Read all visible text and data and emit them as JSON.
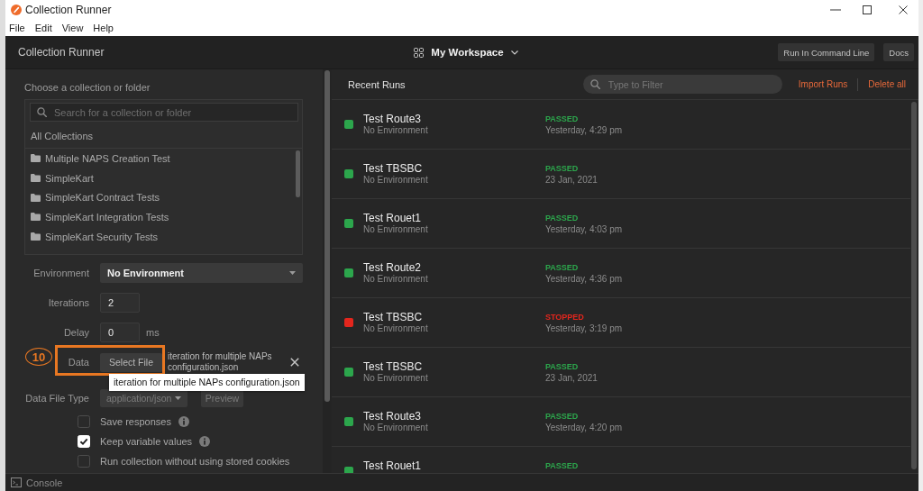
{
  "window": {
    "title": "Collection Runner"
  },
  "menu": [
    "File",
    "Edit",
    "View",
    "Help"
  ],
  "header": {
    "title": "Collection Runner",
    "workspace": "My Workspace",
    "buttons": [
      "Run In Command Line",
      "Docs"
    ]
  },
  "collection_picker": {
    "label": "Choose a collection or folder",
    "search": {
      "placeholder": "Search for a collection or folder"
    },
    "heading": "All Collections",
    "items": [
      "Multiple NAPS Creation Test",
      "SimpleKart",
      "SimpleKart Contract Tests",
      "SimpleKart Integration Tests",
      "SimpleKart Security Tests"
    ]
  },
  "settings": {
    "environment": {
      "label": "Environment",
      "value": "No Environment"
    },
    "iterations": {
      "label": "Iterations",
      "value": "2"
    },
    "delay": {
      "label": "Delay",
      "value": "0",
      "unit": "ms"
    },
    "data": {
      "label": "Data",
      "button": "Select File",
      "file_name": "iteration for multiple NAPs configuration.json",
      "tooltip": "iteration for multiple NAPs configuration.json"
    },
    "data_file_type": {
      "label": "Data File Type",
      "value": "application/json",
      "button": "Preview",
      "disabled": true
    },
    "options": [
      {
        "label": "Save responses",
        "checked": false,
        "info": true
      },
      {
        "label": "Keep variable values",
        "checked": true,
        "info": true
      },
      {
        "label": "Run collection without using stored cookies",
        "checked": false,
        "info": false
      }
    ]
  },
  "callout": {
    "number": "10"
  },
  "recent_runs": {
    "title": "Recent Runs",
    "filter": {
      "placeholder": "Type to Filter"
    },
    "actions": [
      "Import Runs",
      "Delete all"
    ],
    "runs": [
      {
        "name": "Test Route3",
        "environment": "No Environment",
        "status": "PASSED",
        "time": "Yesterday, 4:29 pm",
        "color": "#2ca64c"
      },
      {
        "name": "Test TBSBC",
        "environment": "No Environment",
        "status": "PASSED",
        "time": "23 Jan, 2021",
        "color": "#2ca64c"
      },
      {
        "name": "Test Rouet1",
        "environment": "No Environment",
        "status": "PASSED",
        "time": "Yesterday, 4:03 pm",
        "color": "#2ca64c"
      },
      {
        "name": "Test Route2",
        "environment": "No Environment",
        "status": "PASSED",
        "time": "Yesterday, 4:36 pm",
        "color": "#2ca64c"
      },
      {
        "name": "Test TBSBC",
        "environment": "No Environment",
        "status": "STOPPED",
        "time": "Yesterday, 3:19 pm",
        "color": "#e3261d"
      },
      {
        "name": "Test TBSBC",
        "environment": "No Environment",
        "status": "PASSED",
        "time": "23 Jan, 2021",
        "color": "#2ca64c"
      },
      {
        "name": "Test Route3",
        "environment": "No Environment",
        "status": "PASSED",
        "time": "Yesterday, 4:20 pm",
        "color": "#2ca64c"
      },
      {
        "name": "Test Rouet1",
        "status": "PASSED",
        "color": "#2ca64c"
      }
    ]
  },
  "status_bar": {
    "console": "Console"
  }
}
